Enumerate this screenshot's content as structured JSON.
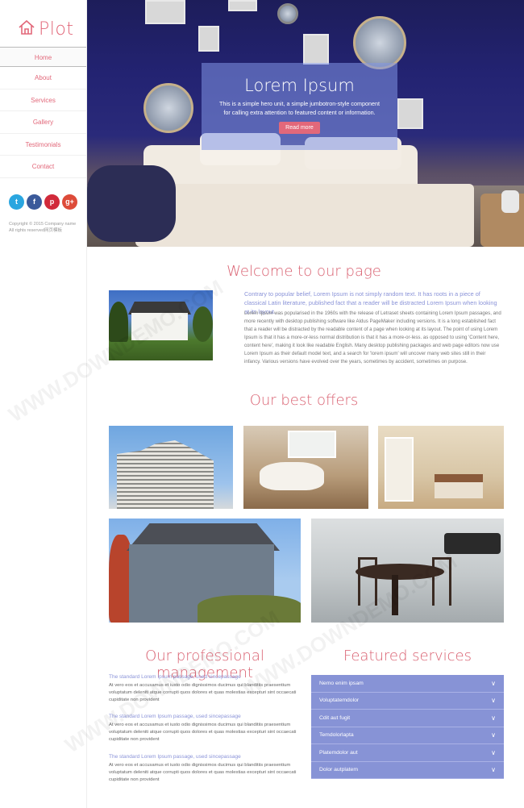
{
  "logo": {
    "text": "Plot",
    "icon": "house-outline-icon",
    "color": "#e2687a"
  },
  "nav": {
    "items": [
      {
        "label": "Home",
        "active": true
      },
      {
        "label": "About"
      },
      {
        "label": "Services"
      },
      {
        "label": "Gallery"
      },
      {
        "label": "Testimonials"
      },
      {
        "label": "Contact"
      }
    ]
  },
  "social": [
    {
      "icon": "twitter-icon",
      "glyph": "t",
      "color": "#2aa6e0"
    },
    {
      "icon": "facebook-icon",
      "glyph": "f",
      "color": "#3b5a9a"
    },
    {
      "icon": "pinterest-icon",
      "glyph": "p",
      "color": "#d12a3a"
    },
    {
      "icon": "google-plus-icon",
      "glyph": "g+",
      "color": "#dd4b39"
    }
  ],
  "copyright": "Copyright © 2015 Company name All rights reserved网页模板",
  "hero": {
    "title": "Lorem Ipsum",
    "text": "This is a simple hero unit, a simple jumbotron-style component for calling extra attention to featured content or information.",
    "button": "Read more"
  },
  "welcome": {
    "title": "Welcome to our page",
    "lead": "Contrary to popular belief, Lorem Ipsum is not simply random text. It has roots in a piece of classical Latin literature, published fact that a reader will be distracted Lorem Ipsum when looking at its layout.",
    "body": "Lorem Ipsum was popularised in the 1960s with the release of Letraset sheets containing Lorem Ipsum passages, and more recently with desktop publishing software like Aldus PageMaker including versions. It is a long established fact that a reader will be distracted by the readable content of a page when looking at its layout. The point of using Lorem Ipsum is that it has a more-or-less normal distribution is that it has a more-or-less. as opposed to using 'Content here, content here', making it look like readable English. Many desktop publishing packages and web page editors now use Lorem Ipsum as their default model text, and a search for 'lorem ipsum' will uncover many web sites still in their infancy. Various versions have evolved over the years, sometimes by accident, sometimes on purpose."
  },
  "offers": {
    "title": "Our best offers"
  },
  "management": {
    "title": "Our professional management",
    "items": [
      {
        "heading": "The standard Lorem Ipsum passage, used sincepassage",
        "text": "At vero eos et accusamus et iusto odio dignissimos ducimus qui blanditiis praesentium voluptatum deleniti atque corrupti quos dolores et quas molestias excepturi sint occaecati cupiditate non provident"
      },
      {
        "heading": "The standard Lorem Ipsum passage, used sincepassage",
        "text": "At vero eos et accusamus et iusto odio dignissimos ducimus qui blanditiis praesentium voluptatum deleniti atque corrupti quos dolores et quas molestias excepturi sint occaecati cupiditate non provident"
      },
      {
        "heading": "The standard Lorem Ipsum passage, used sincepassage",
        "text": "At vero eos et accusamus et iusto odio dignissimos ducimus qui blanditiis praesentium voluptatum deleniti atque corrupti quos dolores et quas molestias excepturi sint occaecati cupiditate non provident"
      }
    ]
  },
  "featured": {
    "title": "Featured services",
    "items": [
      {
        "label": "Nemo enim ipsam"
      },
      {
        "label": "Voluptatemdolor"
      },
      {
        "label": "Cdit aut fugit"
      },
      {
        "label": "Temdolorlapta"
      },
      {
        "label": "Platemdolor aut"
      },
      {
        "label": "Dolor autplatem"
      }
    ]
  },
  "watermark": "WWW.DOWNDEMO.COM",
  "colors": {
    "accent": "#e2687a",
    "lavender": "#8793d6",
    "lead": "#8a93d8"
  }
}
